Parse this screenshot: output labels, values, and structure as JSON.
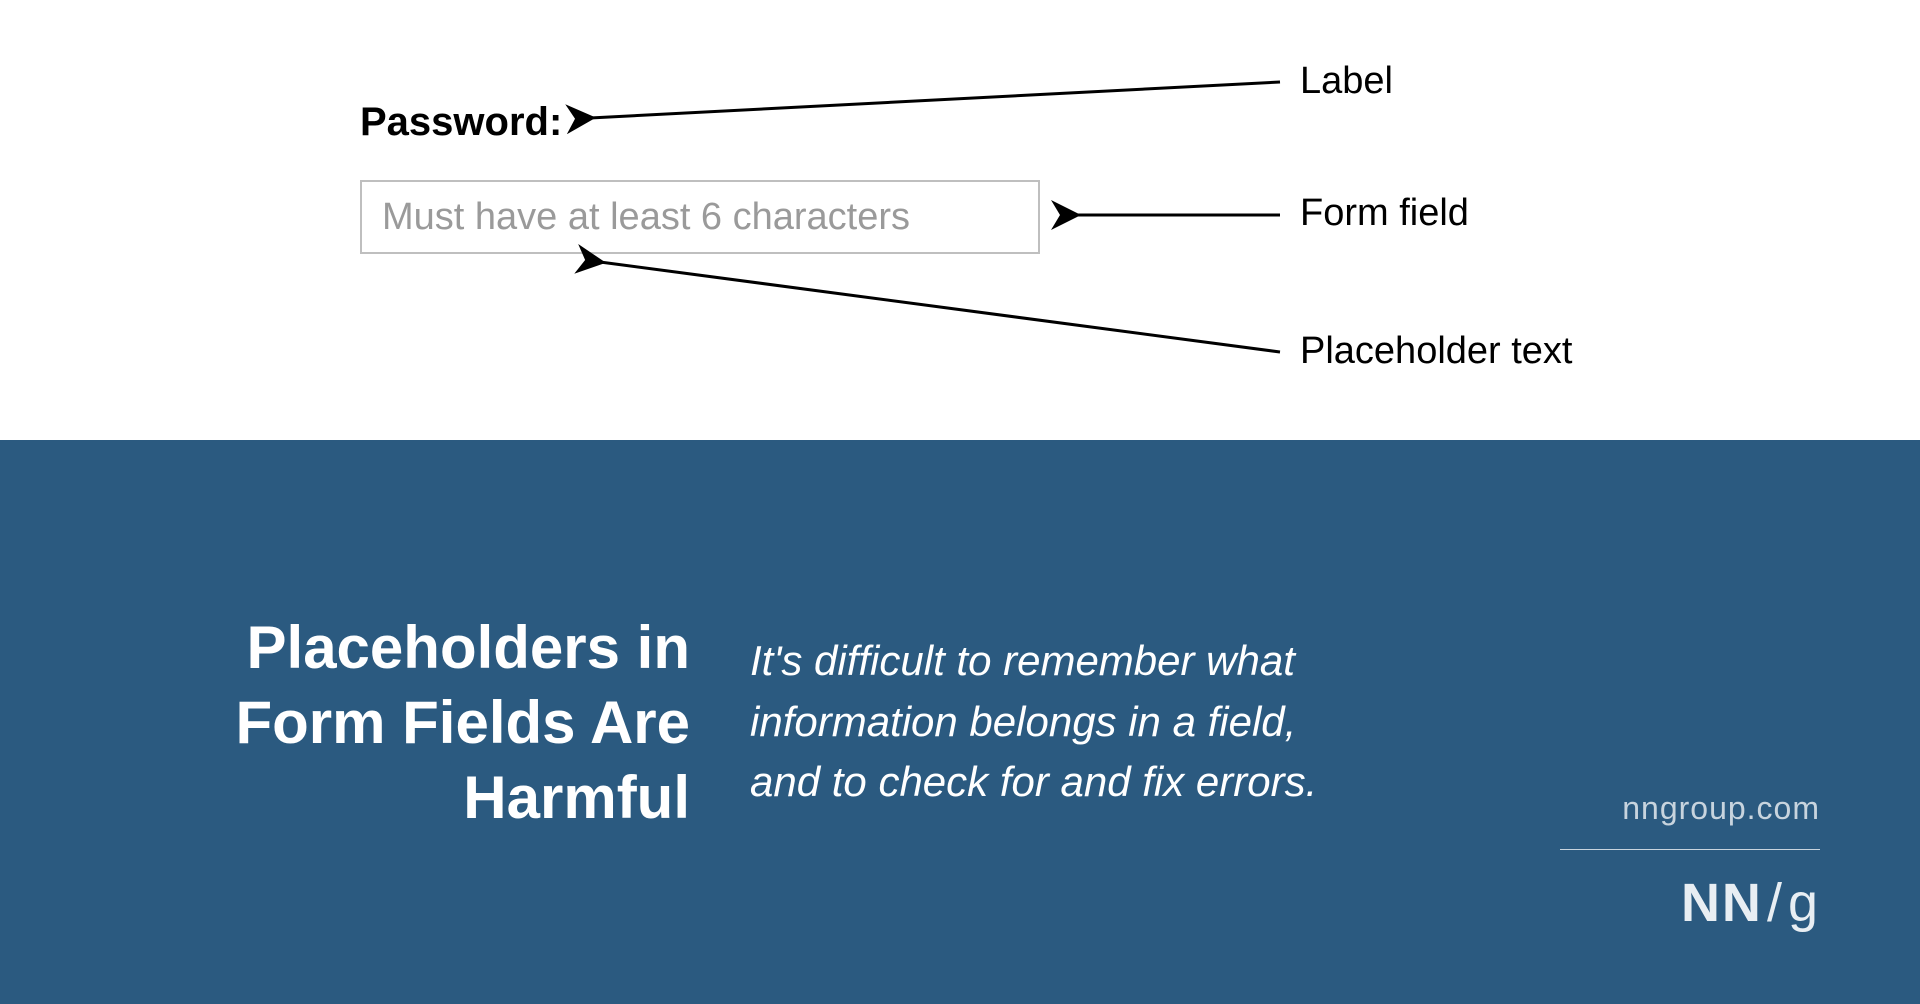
{
  "diagram": {
    "form": {
      "label": "Password:",
      "placeholder": "Must have at least 6 characters"
    },
    "annotations": {
      "label": "Label",
      "field": "Form field",
      "placeholder": "Placeholder text"
    }
  },
  "card": {
    "headline": "Placeholders in Form Fields Are Harmful",
    "description": "It's difficult to remember what information belongs in a field, and to check for and fix errors.",
    "brand_url": "nngroup.com",
    "brand_logo_nn": "NN",
    "brand_logo_slash": "/",
    "brand_logo_g": "g"
  }
}
